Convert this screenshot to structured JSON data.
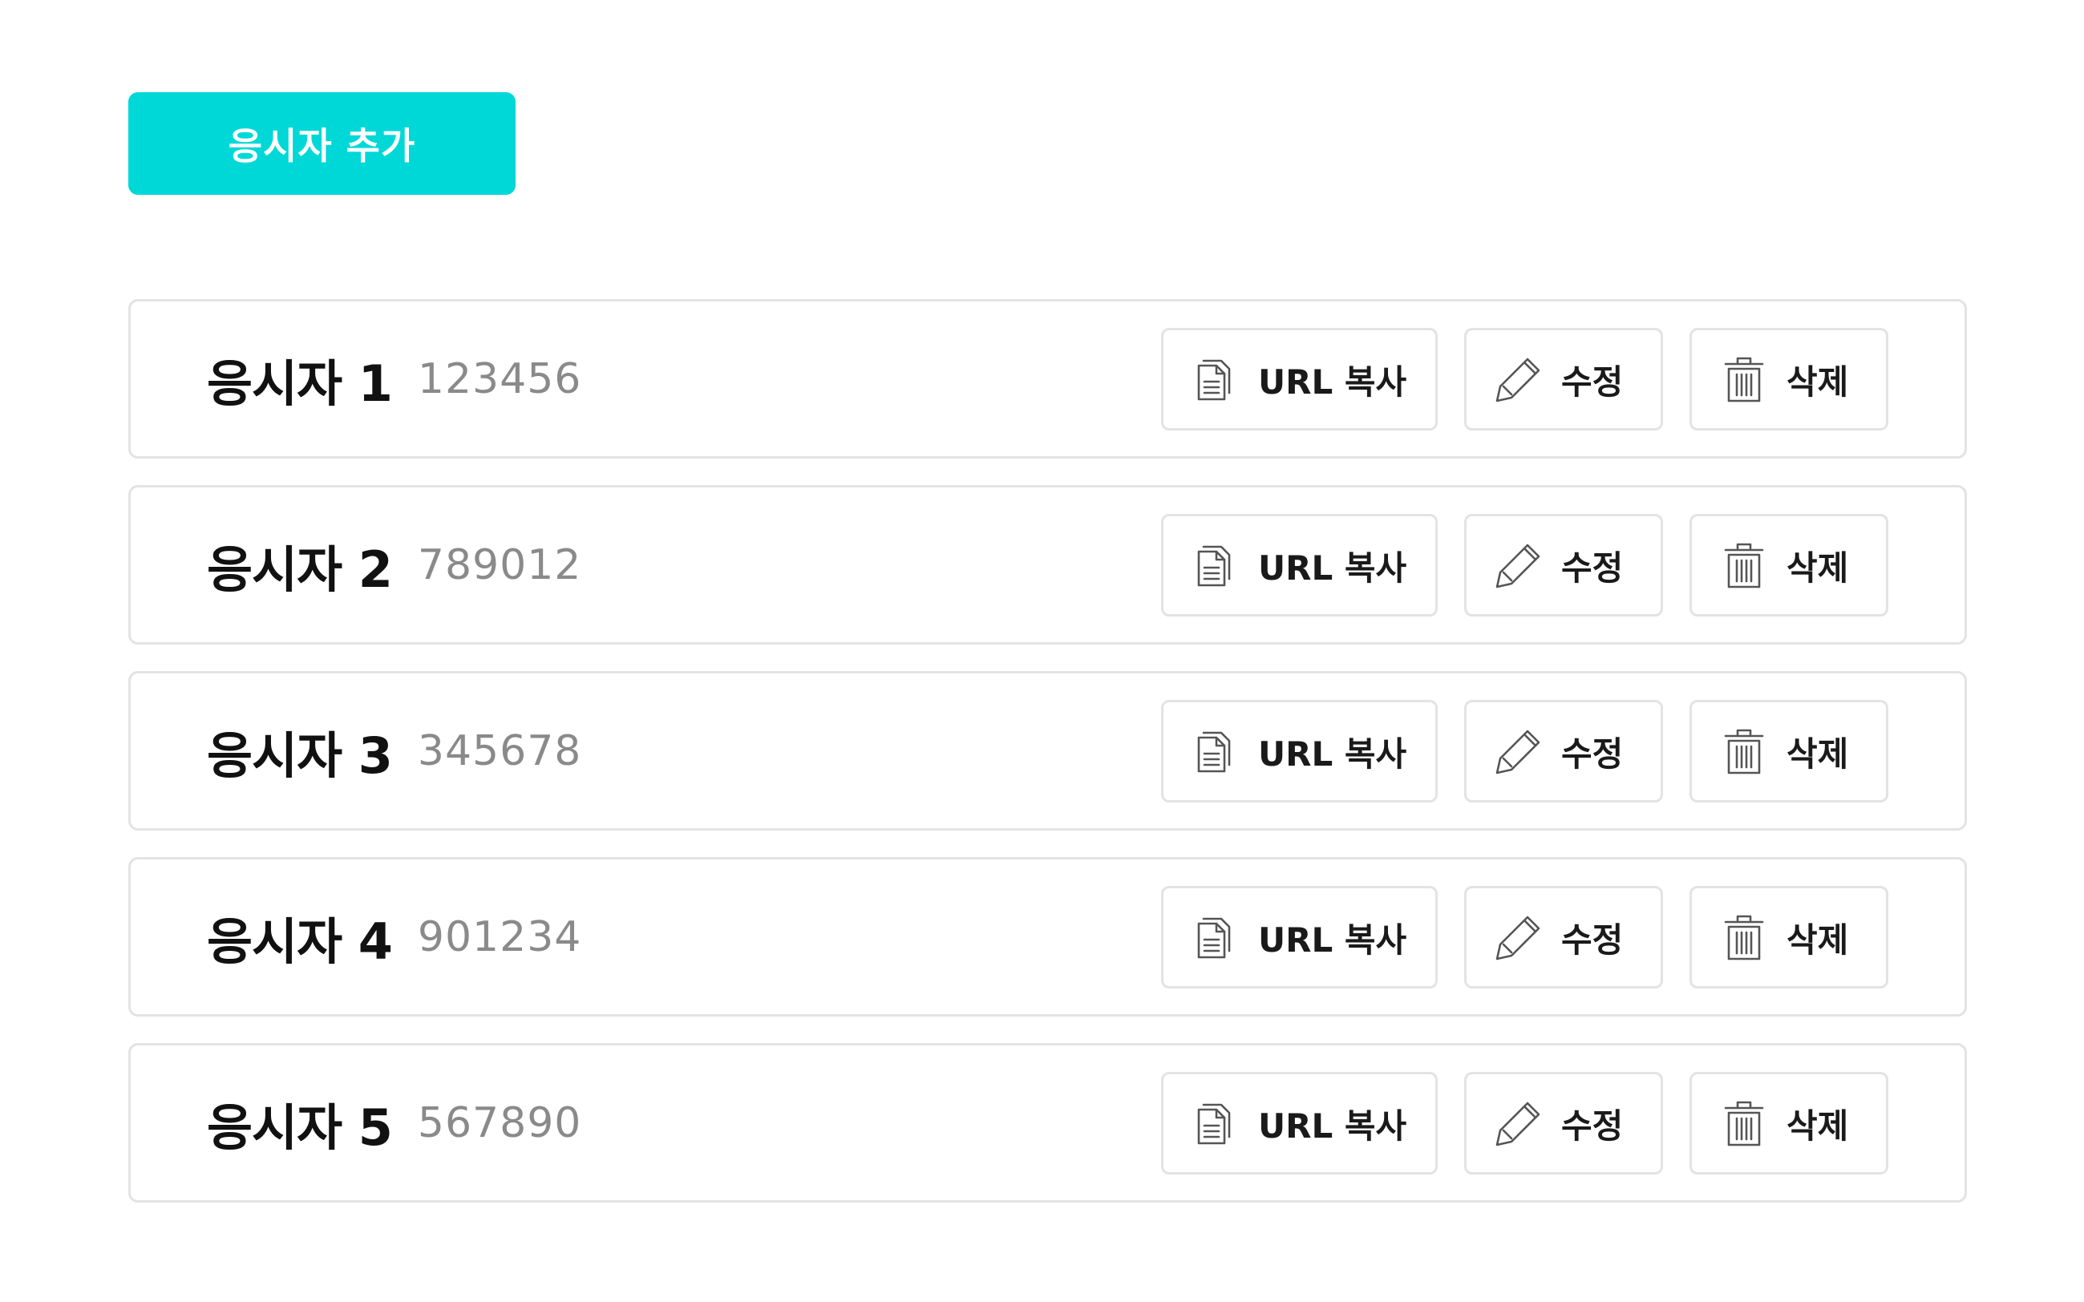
{
  "add_button_label": "응시자 추가",
  "candidates": [
    {
      "name": "응시자 1",
      "code": "123456"
    },
    {
      "name": "응시자 2",
      "code": "789012"
    },
    {
      "name": "응시자 3",
      "code": "345678"
    },
    {
      "name": "응시자 4",
      "code": "901234"
    },
    {
      "name": "응시자 5",
      "code": "567890"
    }
  ],
  "actions": {
    "copy_label": "URL 복사",
    "edit_label": "수정",
    "delete_label": "삭제"
  },
  "icons": {
    "copy": "copy-document-icon",
    "edit": "pencil-icon",
    "delete": "trash-icon"
  },
  "colors": {
    "accent": "#00d8d8",
    "border": "#e3e3e3",
    "code_text": "#8a8a8a"
  }
}
